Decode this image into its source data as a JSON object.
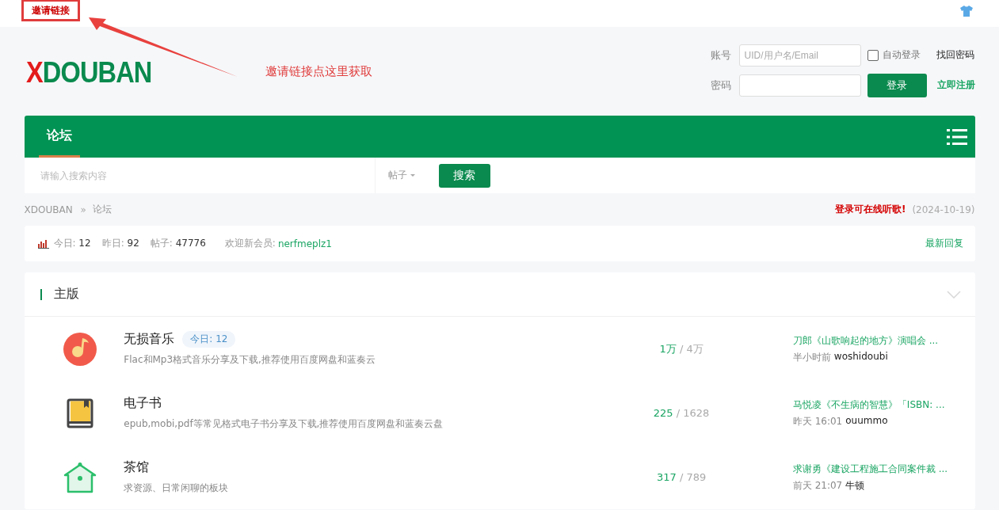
{
  "top_bar": {
    "invite_link": "邀请链接"
  },
  "annotation": {
    "text": "邀请链接点这里获取"
  },
  "logo": {
    "mark": "X",
    "name": "DOUBAN"
  },
  "login": {
    "account_label": "账号",
    "account_placeholder": "UID/用户名/Email",
    "auto_login": {
      "label": "自动登录",
      "checked": false
    },
    "recover_link": "找回密码",
    "password_label": "密码",
    "login_button": "登录",
    "register_link": "立即注册"
  },
  "nav": {
    "tabs": [
      {
        "label": "论坛",
        "selected": true
      }
    ]
  },
  "search": {
    "placeholder": "请输入搜索内容",
    "scope": "帖子",
    "button": "搜索"
  },
  "breadcrumb": {
    "items": [
      "XDOUBAN",
      "论坛"
    ],
    "separator": "»",
    "notice": "登录可在线听歌!",
    "date": "(2024-10-19)"
  },
  "stats": {
    "items": [
      {
        "label": "今日:",
        "value": "12"
      },
      {
        "label": "昨日:",
        "value": "92"
      },
      {
        "label": "帖子:",
        "value": "47776"
      }
    ],
    "welcome_label": "欢迎新会员:",
    "new_member": "nerfmeplz1",
    "latest_link": "最新回复"
  },
  "section": {
    "title": "主版",
    "expanded": true
  },
  "forums": [
    {
      "kind": "music",
      "name": "无损音乐",
      "today": "今日: 12",
      "description": "Flac和Mp3格式音乐分享及下载,推荐使用百度网盘和蓝奏云",
      "threads": "1万",
      "separator": "/",
      "posts": "4万",
      "last_title": "刀郎《山歌响起的地方》演唱会 ...",
      "last_time": "半小时前",
      "last_user": "woshidoubi"
    },
    {
      "kind": "book",
      "name": "电子书",
      "description": "epub,mobi,pdf等常见格式电子书分享及下载,推荐使用百度网盘和蓝奏云盘",
      "threads": "225",
      "separator": "/",
      "posts": "1628",
      "last_title": "马悦凌《不生病的智慧》「ISBN: ...",
      "last_time": "昨天 16:01",
      "last_user": "ouummo"
    },
    {
      "kind": "house",
      "name": "茶馆",
      "description": "求资源、日常闲聊的板块",
      "threads": "317",
      "separator": "/",
      "posts": "789",
      "last_title": "求谢勇《建设工程施工合同案件裁 ...",
      "last_time": "前天 21:07",
      "last_user": "牛顿"
    }
  ]
}
